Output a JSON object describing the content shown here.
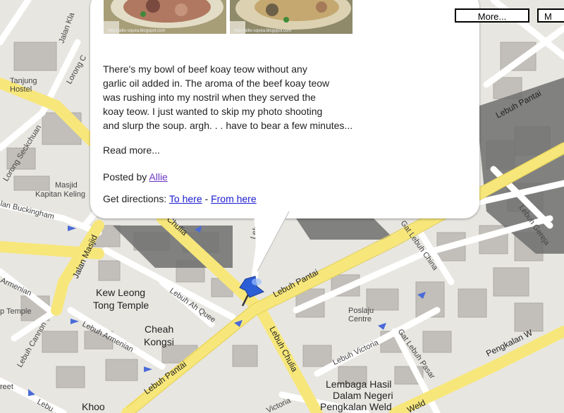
{
  "controls": {
    "more_label": "More...",
    "map_type_label": "M"
  },
  "colors": {
    "road_major": "#f7e77a",
    "road_minor": "#ffffff",
    "land": "#e8e6e1",
    "building": "#bfbcb7",
    "shadow": "#6f6f6f",
    "link": "#1a1ad0",
    "visited_link": "#6b34c4",
    "pin": "#2c5ed6"
  },
  "infowindow": {
    "photo_caption": "http://allie-squea.blogspot.com",
    "description": "There's my bowl of beef koay teow without any\ngarlic oil added in. The aroma of the beef koay teow\nwas rushing into my nostril when they served the\nkoay teow. I just wanted to skip my photo shooting\nand slurp the soup. argh. . . have to bear a few minutes...",
    "read_more": "Read more...",
    "posted_by_prefix": "Posted by",
    "author": "Allie",
    "directions_prefix": "Get directions:",
    "to_here": "To here",
    "separator": "-",
    "from_here": "From here"
  },
  "map_labels": {
    "jalan_kl": "Jalan Kla",
    "lorong_c": "Lorong C",
    "tanjung": "Tanjung",
    "hostel": "Hostel",
    "lorong_seckchuan": "Lorong Seckchuan",
    "masjid": "Masjid",
    "kapitan_keling": "Kapitan Keling",
    "lan_buckingham": "lan Buckingham",
    "jalan_masjid": "Jalan Masjid",
    "armenian": "Armenian",
    "p_temple": "p Temple",
    "kew_leong": "Kew Leong",
    "tong_temple": "Tong Temple",
    "cheah": "Cheah",
    "kongsi": "Kongsi",
    "lebuh_cannon": "Lebuh Cannon",
    "lebuh_armenian": "Lebuh Armenian",
    "lebuh_ah_quee": "Lebuh Ah Quee",
    "lebuh_pantai_bottom": "Lebuh Pantai",
    "lebuh_pantai_mid": "Lebuh Pantai",
    "lebuh_pantai_top": "Lebuh Pantai",
    "lebuh_chulia_top": "Chulia",
    "lebuh_chulia_bottom": "Lebuh Chulia",
    "lebuh_penang": "Lebuh Penan",
    "gat_lebuh_china": "Gat Lebuh China",
    "lebuh_gereja": "Lebuh Gereja",
    "poslaju": "Poslaju",
    "centre": "Centre",
    "lebuh_victoria": "Lebuh Victoria",
    "victoria_bottom": "Victoria",
    "gat_lebuh_pasar": "Gat Lebuh Pasar",
    "lembaga": "Lembaga Hasil",
    "dalam_negeri": "Dalam Negeri",
    "pengkalan_weld": "Pengkalan Weld",
    "pengkalan_weld_road": "Pengkalan W",
    "weld": "Weld",
    "khoo": "Khoo",
    "reet": "reet",
    "lebu": "Lebu"
  }
}
